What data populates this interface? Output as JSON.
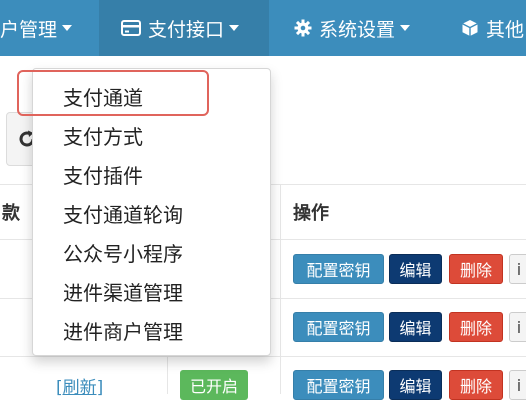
{
  "nav": {
    "items": [
      {
        "label": "户管理",
        "icon": "none"
      },
      {
        "label": "支付接口",
        "icon": "credit-card-icon"
      },
      {
        "label": "系统设置",
        "icon": "gear-icon"
      },
      {
        "label": "其他",
        "icon": "cube-icon"
      }
    ]
  },
  "dropdown": {
    "items": [
      {
        "label": "支付通道"
      },
      {
        "label": "支付方式"
      },
      {
        "label": "支付插件"
      },
      {
        "label": "支付通道轮询"
      },
      {
        "label": "公众号小程序"
      },
      {
        "label": "进件渠道管理"
      },
      {
        "label": "进件商户管理"
      }
    ],
    "highlighted_index": 0
  },
  "table": {
    "header_partial": "款",
    "header_actions": "操作",
    "rows": [
      {
        "link": "",
        "status": "",
        "btn_key": "配置密钥",
        "btn_edit": "编辑",
        "btn_delete": "删除",
        "btn_more": "i"
      },
      {
        "link": "",
        "status": "",
        "btn_key": "配置密钥",
        "btn_edit": "编辑",
        "btn_delete": "删除",
        "btn_more": "i"
      },
      {
        "link": "[刷新]",
        "status": "已开启",
        "btn_key": "配置密钥",
        "btn_edit": "编辑",
        "btn_delete": "删除",
        "btn_more": "i"
      }
    ]
  },
  "colors": {
    "nav_bg": "#3c8dbc",
    "nav_active": "#367fa9",
    "btn_primary": "#3c8dbc",
    "btn_edit": "#0d3a72",
    "btn_delete": "#dd4b39",
    "status_on": "#5cb85c",
    "highlight": "#e0645c"
  }
}
